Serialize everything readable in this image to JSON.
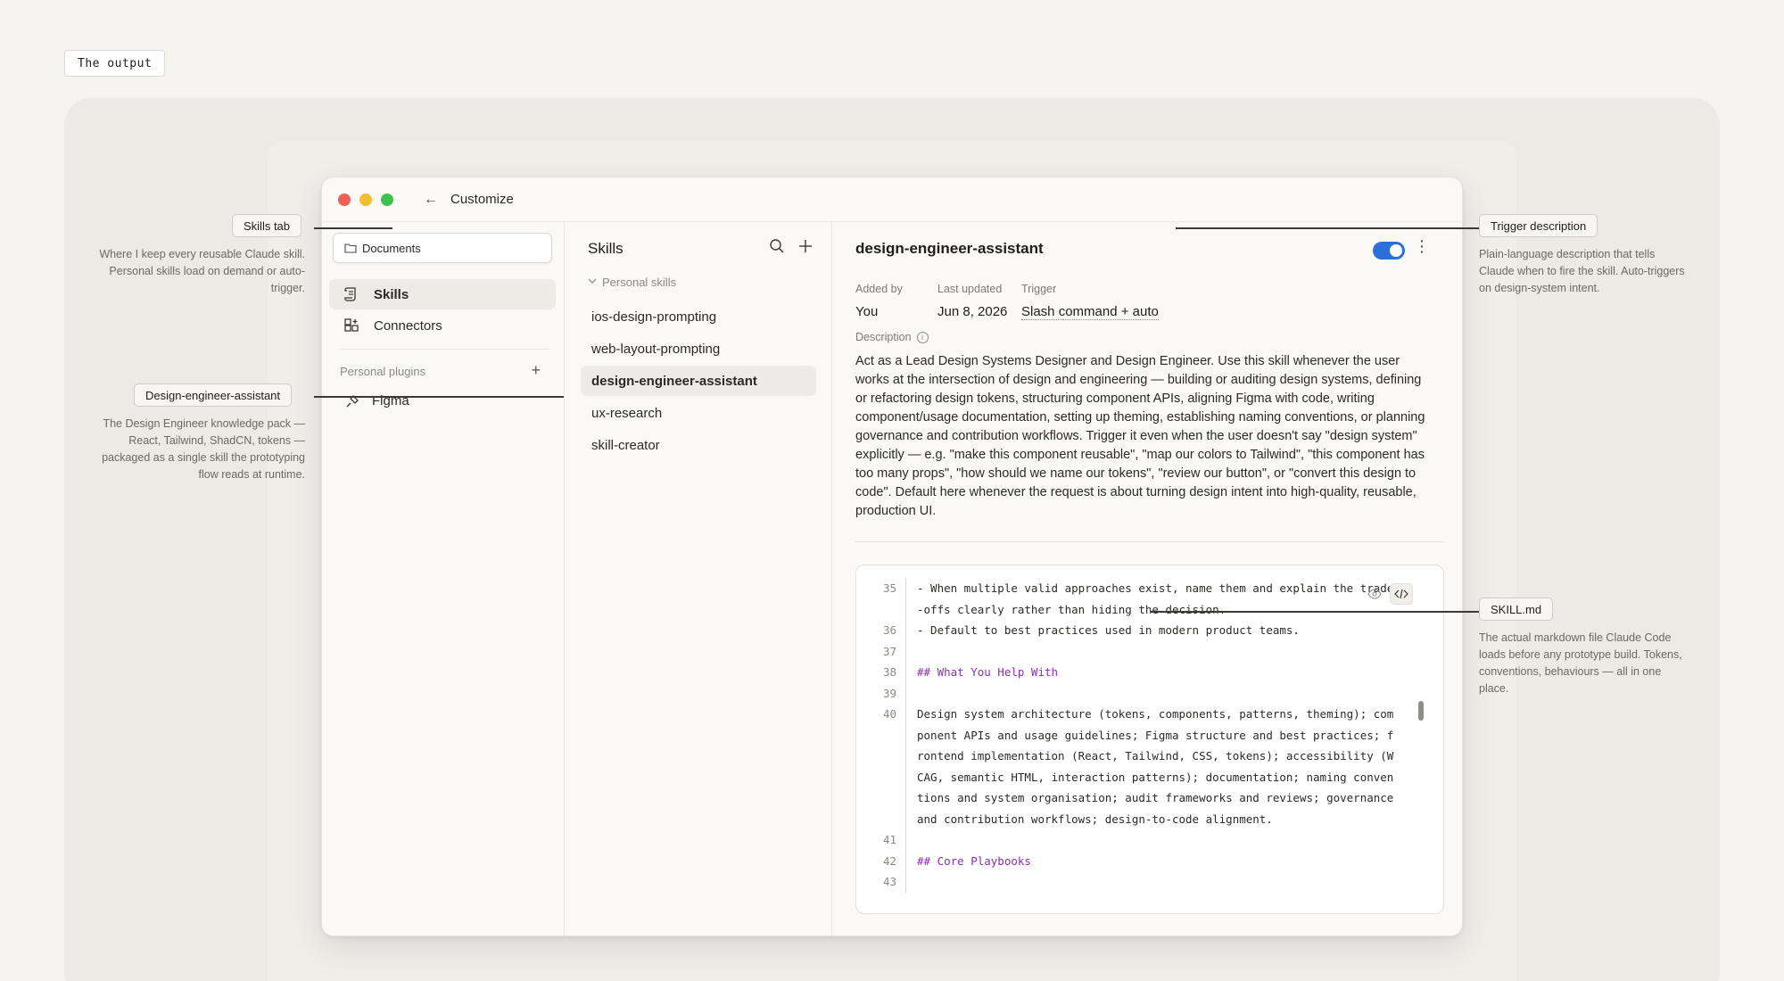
{
  "output_tag": "The output",
  "window": {
    "title": "Customize"
  },
  "sidebar": {
    "documents_label": "Documents",
    "items": [
      {
        "label": "Skills",
        "active": true
      },
      {
        "label": "Connectors",
        "active": false
      }
    ],
    "plugins_label": "Personal plugins",
    "plugins": [
      {
        "label": "Figma"
      }
    ]
  },
  "skills": {
    "title": "Skills",
    "group_label": "Personal skills",
    "items": [
      {
        "label": "ios-design-prompting"
      },
      {
        "label": "web-layout-prompting"
      },
      {
        "label": "design-engineer-assistant"
      },
      {
        "label": "ux-research"
      },
      {
        "label": "skill-creator"
      }
    ]
  },
  "detail": {
    "title": "design-engineer-assistant",
    "enabled": true,
    "added_by_label": "Added by",
    "added_by": "You",
    "updated_label": "Last updated",
    "updated": "Jun 8, 2026",
    "trigger_label": "Trigger",
    "trigger": "Slash command + auto",
    "description_label": "Description",
    "description": "Act as a Lead Design Systems Designer and Design Engineer. Use this skill whenever the user works at the intersection of design and engineering — building or auditing design systems, defining or refactoring design tokens, structuring component APIs, aligning Figma with code, writing component/usage documentation, setting up theming, establishing naming conventions, or planning governance and contribution workflows. Trigger it even when the user doesn't say \"design system\" explicitly — e.g. \"make this component reusable\", \"map our colors to Tailwind\", \"this component has too many props\", \"how should we name our tokens\", \"review our button\", or \"convert this design to code\". Default here whenever the request is about turning design intent into high-quality, reusable, production UI."
  },
  "code": {
    "lines": [
      {
        "n": "35",
        "text": "- When multiple valid approaches exist, name them and explain the trade-offs clearly rather than hiding the decision.",
        "heading": false
      },
      {
        "n": "36",
        "text": "- Default to best practices used in modern product teams.",
        "heading": false
      },
      {
        "n": "37",
        "text": "",
        "heading": false
      },
      {
        "n": "38",
        "text": "## What You Help With",
        "heading": true
      },
      {
        "n": "39",
        "text": "",
        "heading": false
      },
      {
        "n": "40",
        "text": "Design system architecture (tokens, components, patterns, theming); component APIs and usage guidelines; Figma structure and best practices; frontend implementation (React, Tailwind, CSS, tokens); accessibility (WCAG, semantic HTML, interaction patterns); documentation; naming conventions and system organisation; audit frameworks and reviews; governance and contribution workflows; design-to-code alignment.",
        "heading": false
      },
      {
        "n": "41",
        "text": "",
        "heading": false
      },
      {
        "n": "42",
        "text": "## Core Playbooks",
        "heading": true
      },
      {
        "n": "43",
        "text": "",
        "heading": false
      }
    ]
  },
  "callouts": {
    "skills_tab": {
      "label": "Skills tab",
      "text": "Where I keep every reusable Claude skill. Personal skills load on demand or auto-trigger."
    },
    "design_engineer": {
      "label": "Design-engineer-assistant",
      "text": "The Design Engineer knowledge pack — React, Tailwind, ShadCN, tokens — packaged as a single skill the prototyping flow reads at runtime."
    },
    "trigger": {
      "label": "Trigger description",
      "text": "Plain-language description that tells Claude when to fire the skill. Auto-triggers on design-system intent."
    },
    "skill_md": {
      "label": "SKILL.md",
      "text": "The actual markdown file Claude Code loads before any prototype build. Tokens, conventions, behaviours — all in one place."
    }
  },
  "colors": {
    "accent": "#2c6fd6",
    "heading": "#8b2fb8",
    "background": "#f5f4f0"
  }
}
